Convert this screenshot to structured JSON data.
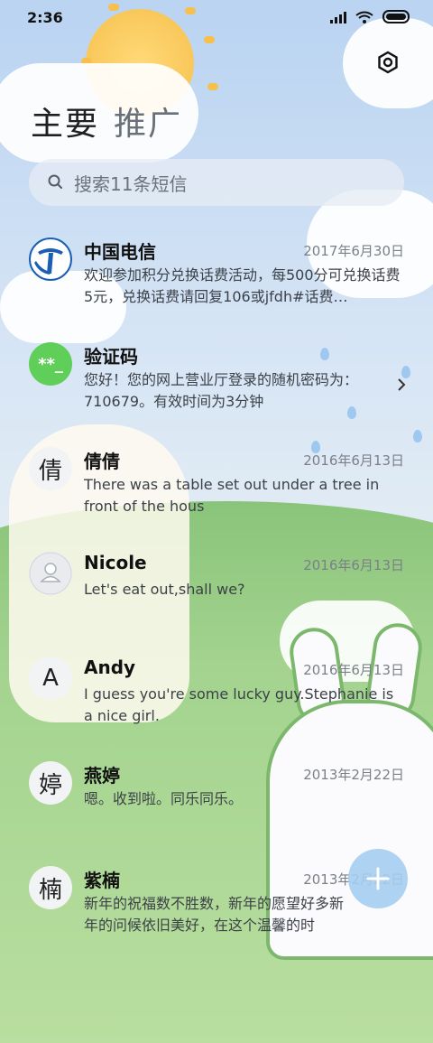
{
  "status": {
    "time": "2:36"
  },
  "tabs": [
    {
      "label": "主要",
      "active": true
    },
    {
      "label": "推广",
      "active": false
    }
  ],
  "search": {
    "placeholder": "搜索11条短信"
  },
  "conversations": [
    {
      "name": "中国电信",
      "date": "2017年6月30日",
      "preview": "欢迎参加积分兑换话费活动，每500分可兑换话费5元，兑换话费请回复106或jfdh#话费…",
      "avatar": "telecom-logo"
    },
    {
      "name": "验证码",
      "date": "",
      "preview": "您好！您的网上营业厅登录的随机密码为：710679。有效时间为3分钟",
      "avatar_text": "**_",
      "avatar_color": "#5fcf5a"
    },
    {
      "name": "倩倩",
      "date": "2016年6月13日",
      "preview": "There was a table set out under a tree in front of the hous",
      "avatar_text": "倩"
    },
    {
      "name": "Nicole",
      "date": "2016年6月13日",
      "preview": "Let's eat out,shall we?",
      "avatar": "person-icon"
    },
    {
      "name": "Andy",
      "date": "2016年6月13日",
      "preview": "I guess you're some lucky guy.Stephanie is a nice girl.",
      "avatar_text": "A"
    },
    {
      "name": "燕婷",
      "date": "2013年2月22日",
      "preview": "嗯。收到啦。同乐同乐。",
      "avatar_text": "婷"
    },
    {
      "name": "紫楠",
      "date": "2013年2月22日",
      "preview": "新年的祝福数不胜数，新年的愿望好多新年的问候依旧美好，在这个温馨的时",
      "avatar_text": "楠"
    }
  ],
  "colors": {
    "accent": "#5fcf5a",
    "fab": "#a5cdf0"
  }
}
